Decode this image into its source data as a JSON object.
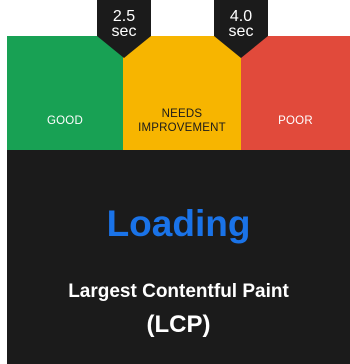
{
  "gauge": {
    "zones": {
      "good": {
        "label": "GOOD",
        "color": "#18a154"
      },
      "needs_improvement": {
        "label_line1": "NEEDS",
        "label_line2": "IMPROVEMENT",
        "color": "#f7b500"
      },
      "poor": {
        "label": "POOR",
        "color": "#e14a3b"
      }
    },
    "thresholds": [
      {
        "value": "2.5",
        "unit": "sec"
      },
      {
        "value": "4.0",
        "unit": "sec"
      }
    ]
  },
  "panel": {
    "status": "Loading",
    "status_color": "#1a73e8",
    "metric_name": "Largest Contentful Paint",
    "metric_abbr": "(LCP)"
  }
}
